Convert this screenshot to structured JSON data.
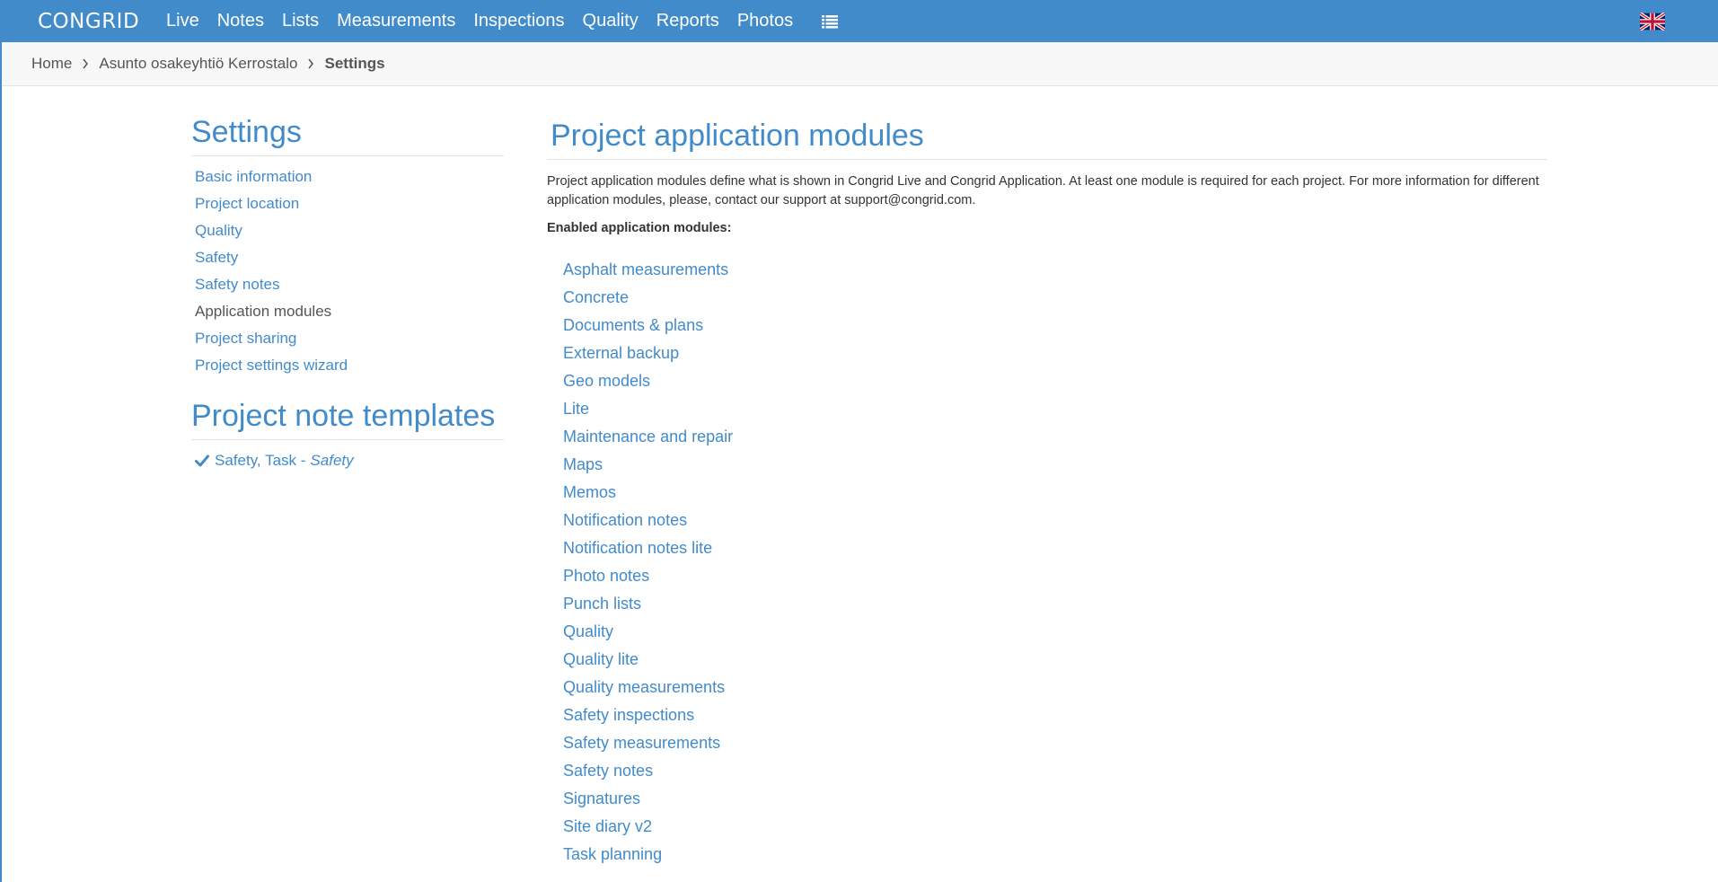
{
  "navbar": {
    "logo": "CONGRID",
    "items": [
      "Live",
      "Notes",
      "Lists",
      "Measurements",
      "Inspections",
      "Quality",
      "Reports",
      "Photos"
    ],
    "list_icon": "list-icon",
    "flag_icon": "uk-flag-icon"
  },
  "breadcrumb": {
    "home": "Home",
    "project": "Asunto osakeyhtiö Kerrostalo",
    "current": "Settings"
  },
  "sidebar": {
    "title": "Settings",
    "items": [
      {
        "label": "Basic information",
        "active": false
      },
      {
        "label": "Project location",
        "active": false
      },
      {
        "label": "Quality",
        "active": false
      },
      {
        "label": "Safety",
        "active": false
      },
      {
        "label": "Safety notes",
        "active": false
      },
      {
        "label": "Application modules",
        "active": true
      },
      {
        "label": "Project sharing",
        "active": false
      },
      {
        "label": "Project settings wizard",
        "active": false
      }
    ],
    "templates_title": "Project note templates",
    "template": {
      "label": "Safety, Task -",
      "type": "Safety",
      "icon": "check-icon"
    }
  },
  "main": {
    "title": "Project application modules",
    "description": "Project application modules define what is shown in Congrid Live and Congrid Application. At least one module is required for each project. For more information for different application modules, please, contact our support at support@congrid.com.",
    "enabled_label": "Enabled application modules:",
    "modules": [
      "Asphalt measurements",
      "Concrete",
      "Documents & plans",
      "External backup",
      "Geo models",
      "Lite",
      "Maintenance and repair",
      "Maps",
      "Memos",
      "Notification notes",
      "Notification notes lite",
      "Photo notes",
      "Punch lists",
      "Quality",
      "Quality lite",
      "Quality measurements",
      "Safety inspections",
      "Safety measurements",
      "Safety notes",
      "Signatures",
      "Site diary v2",
      "Task planning"
    ]
  },
  "colors": {
    "brand": "#428bca",
    "text": "#333333",
    "muted": "#555555"
  }
}
